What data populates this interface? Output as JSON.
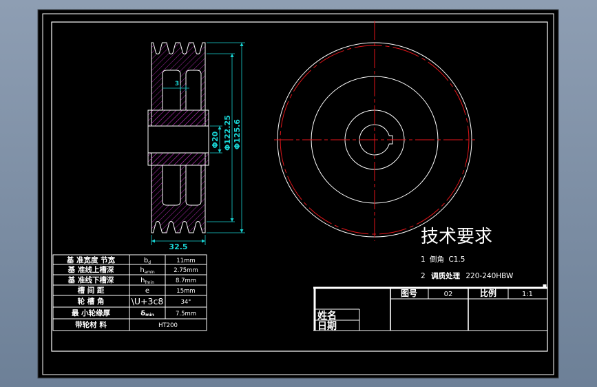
{
  "viewer": {
    "background_top": "#8e9eb3",
    "background_bottom": "#6d8097",
    "canvas": "#000000"
  },
  "colors": {
    "outline": "#ffffff",
    "hatch": "#b02ab0",
    "dimension": "#19d3d3",
    "centerline": "#e3151a"
  },
  "section_view": {
    "dim_web": "3",
    "dim_bore": "Φ20",
    "dim_pitch": "Φ122.25",
    "dim_outer": "Φ125.6",
    "dim_width": "32.5"
  },
  "technical_requirements": {
    "title": "技术要求",
    "items": [
      {
        "no": "1",
        "text": "倒角",
        "value": "C1.5"
      },
      {
        "no": "2",
        "text": "调质处理",
        "value": "220-240HBW"
      }
    ]
  },
  "parameter_table": {
    "rows": [
      {
        "label": "基 准宽度 节宽",
        "symbol": "b",
        "sub": "d",
        "value": "11mm"
      },
      {
        "label": "基 准线上槽深",
        "symbol": "h",
        "sub": "amin",
        "value": "2.75mm"
      },
      {
        "label": "基 准线下槽深",
        "symbol": "h",
        "sub": "fmin",
        "value": "8.7mm"
      },
      {
        "label": "槽 间 距",
        "symbol": "e",
        "value": "15mm"
      },
      {
        "label": "轮 槽 角",
        "symbol": "\\U+3c8",
        "value": "34°"
      },
      {
        "label": "最 小轮缘厚",
        "symbol": "δ",
        "sub": "min",
        "value": "7.5mm"
      }
    ],
    "material": {
      "label": "带轮材 料",
      "value": "HT200"
    }
  },
  "title_block": {
    "drawing_no_label": "图号",
    "drawing_no": "02",
    "scale_label": "比例",
    "scale": "1:1",
    "name_label": "姓名",
    "date_label": "日期"
  }
}
